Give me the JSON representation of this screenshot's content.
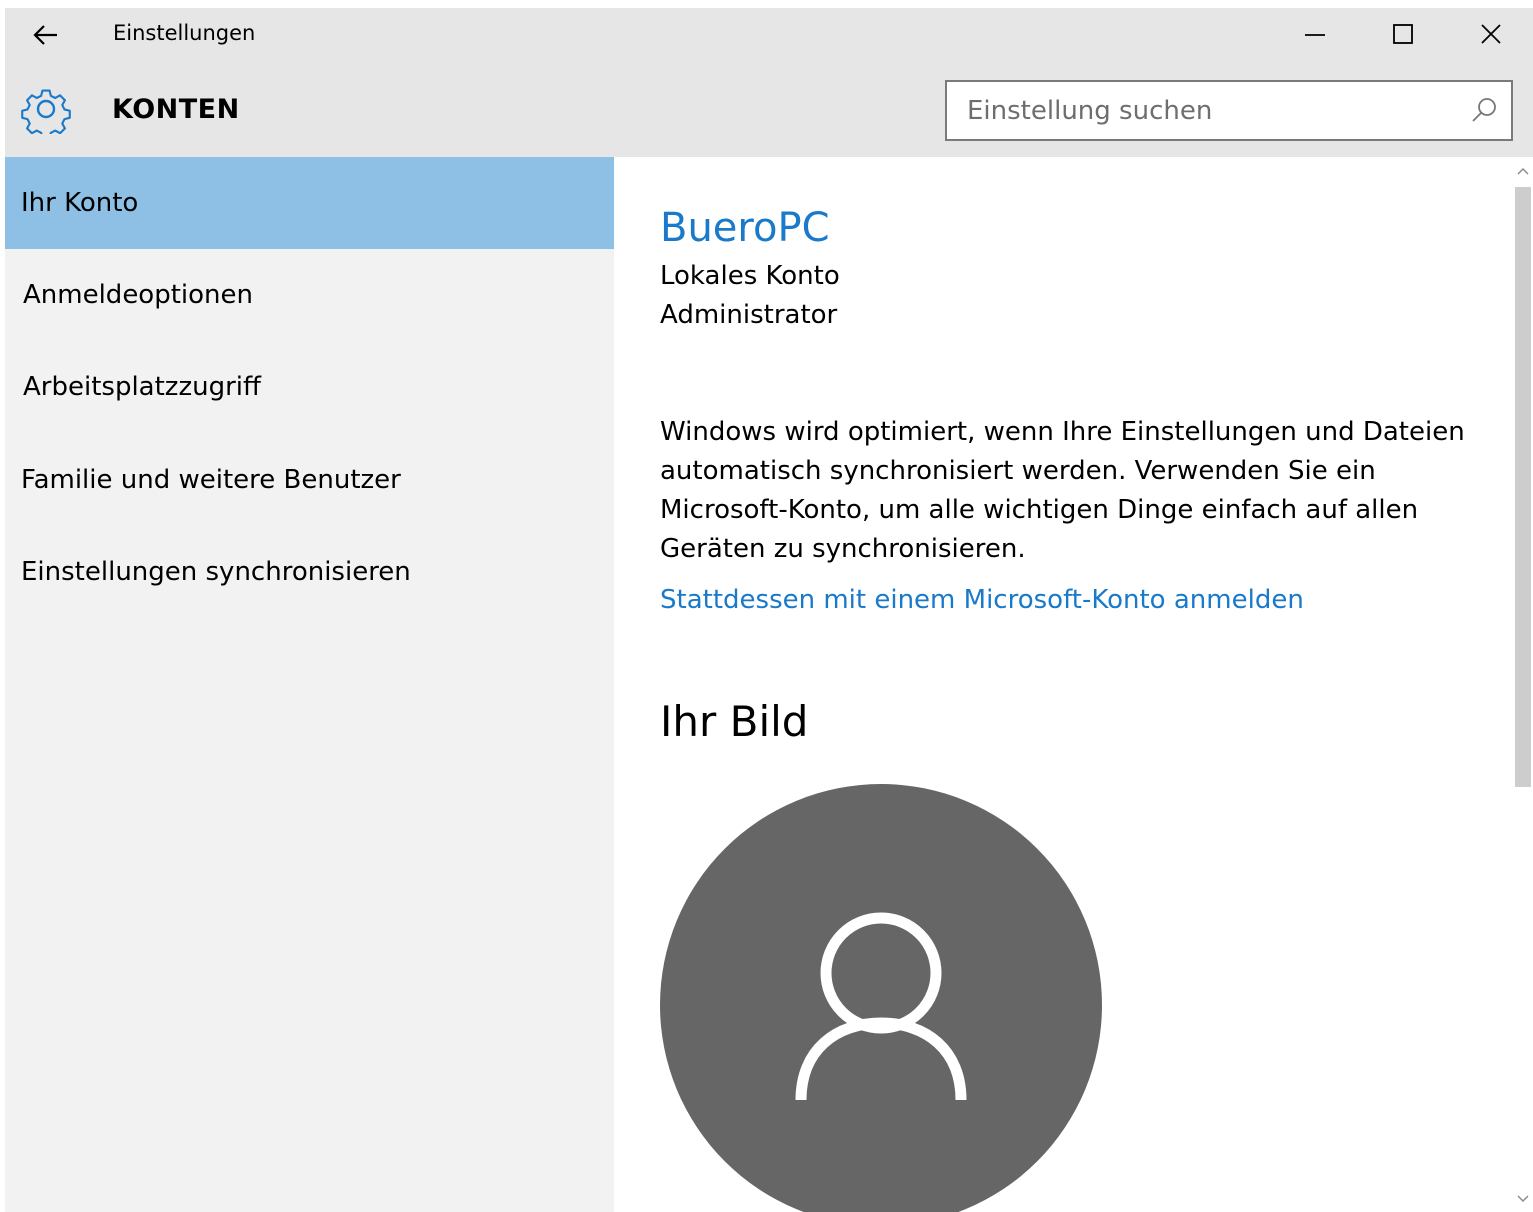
{
  "window": {
    "title": "Einstellungen",
    "back_icon": "back-arrow-icon",
    "controls": [
      "minimize-icon",
      "maximize-icon",
      "close-icon"
    ]
  },
  "header": {
    "icon": "gear-icon",
    "title": "KONTEN",
    "search": {
      "placeholder": "Einstellung suchen",
      "value": "",
      "icon": "search-icon"
    }
  },
  "sidebar": {
    "items": [
      {
        "label": "Ihr Konto",
        "selected": true
      },
      {
        "label": "Anmeldeoptionen",
        "selected": false
      },
      {
        "label": "Arbeitsplatzzugriff",
        "selected": false
      },
      {
        "label": "Familie und weitere Benutzer",
        "selected": false
      },
      {
        "label": "Einstellungen synchronisieren",
        "selected": false
      }
    ]
  },
  "main": {
    "user_name": "BueroPC",
    "account_type": "Lokales Konto",
    "account_role": "Administrator",
    "info_text": "Windows wird optimiert, wenn Ihre Einstellungen und Dateien automatisch synchronisiert werden. Verwenden Sie ein Microsoft-Konto, um alle wichtigen Dinge einfach auf allen Geräten zu synchronisieren.",
    "ms_link": "Stattdessen mit einem Microsoft-Konto anmelden",
    "picture_heading": "Ihr Bild",
    "avatar_icon": "user-avatar-icon"
  },
  "colors": {
    "accent": "#1979ca",
    "selected_bg": "#8ec0e6",
    "chrome_bg": "#e6e6e6",
    "sidebar_bg": "#f2f2f2",
    "avatar_bg": "#666666"
  }
}
